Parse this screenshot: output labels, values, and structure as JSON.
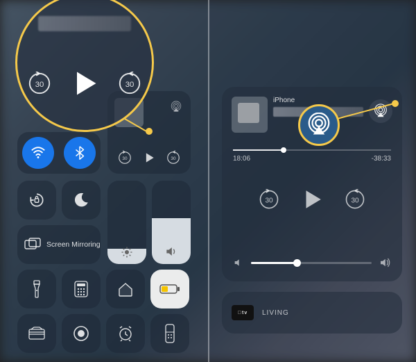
{
  "screen_mirror_label": "Screen Mirroring",
  "skip_back_seconds": "30",
  "skip_forward_seconds": "30",
  "right": {
    "device_label": "iPhone",
    "elapsed": "18:06",
    "remaining": "-38:33",
    "progress_pct": 32,
    "volume_pct": 38,
    "living_label": "LIVING",
    "atv_label": "tv"
  },
  "left": {
    "brightness_pct": 18,
    "volume_pct": 55
  }
}
